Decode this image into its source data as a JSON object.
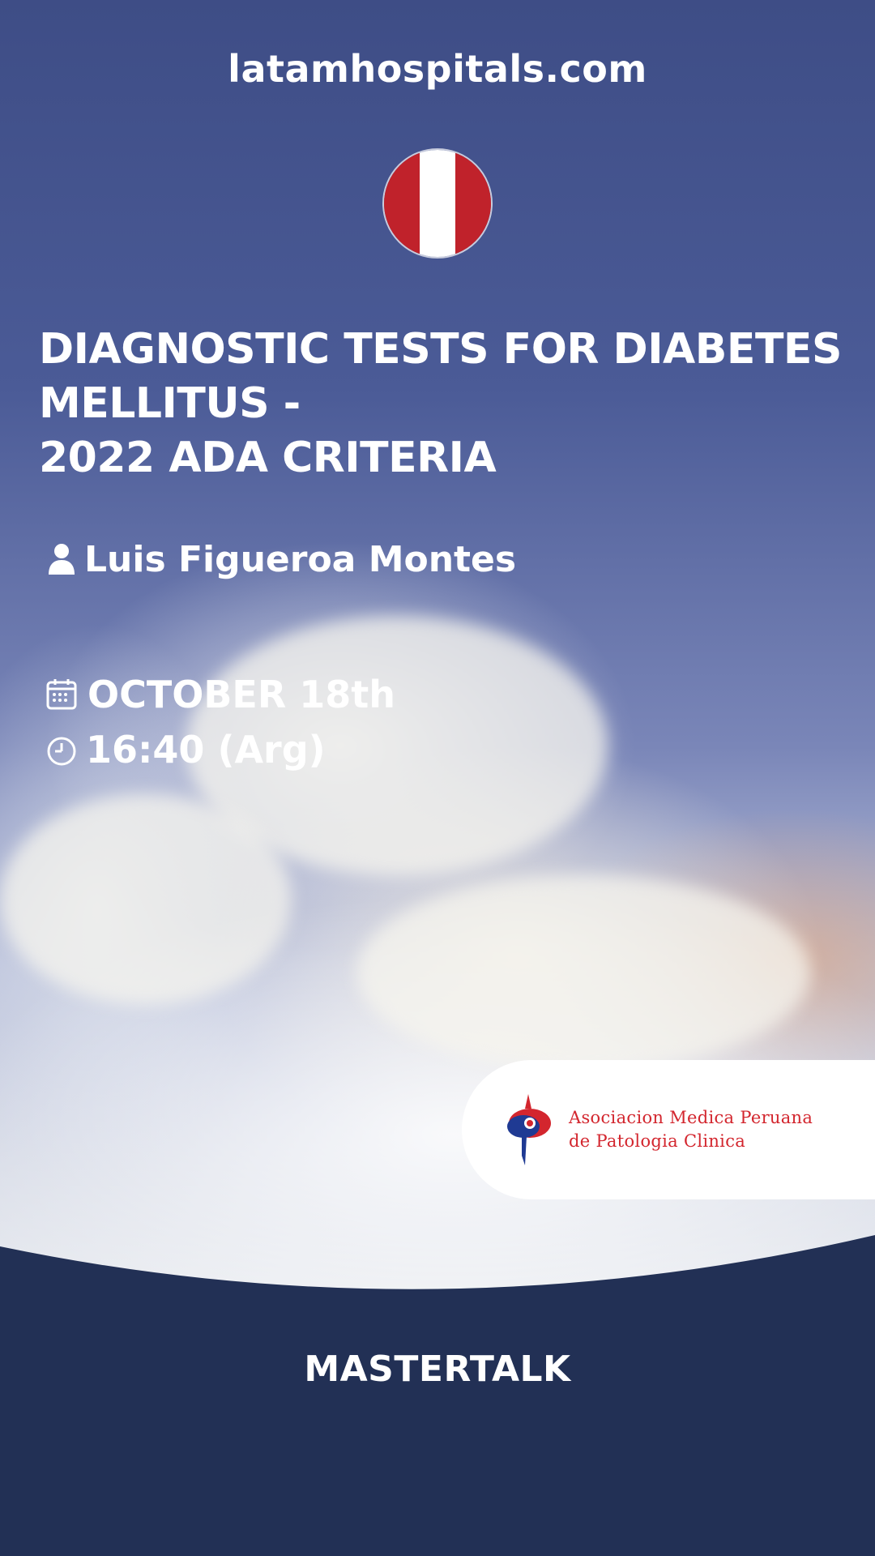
{
  "header": {
    "site": "latamhospitals.com"
  },
  "flag": {
    "colors": [
      "#c0222b",
      "#ffffff",
      "#c0222b"
    ]
  },
  "event": {
    "title_lines": [
      "DIAGNOSTIC TESTS FOR DIABETES",
      "MELLITUS -",
      "2022 ADA CRITERIA"
    ],
    "speaker": "Luis Figueroa Montes",
    "date": "OCTOBER 18th",
    "time": "16:40 (Arg)"
  },
  "partner": {
    "line1": "Asociacion Medica Peruana",
    "line2": "de Patologia  Clinica",
    "colors": {
      "red": "#d3262e",
      "blue": "#1f3a93"
    }
  },
  "footer": {
    "label": "MASTERTALK",
    "color": "#223055"
  },
  "icons": {
    "speaker": "user-icon",
    "date": "calendar-icon",
    "time": "clock-icon"
  }
}
